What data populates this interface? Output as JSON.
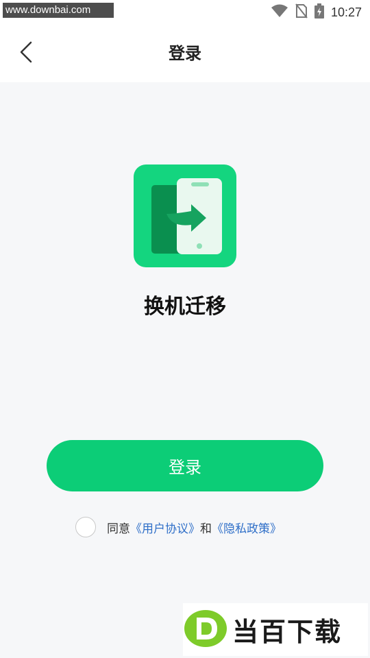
{
  "status_bar": {
    "watermark_url": "www.downbai.com",
    "time": "10:27"
  },
  "nav": {
    "title": "登录"
  },
  "app": {
    "name": "换机迁移"
  },
  "login": {
    "button_label": "登录"
  },
  "agreement": {
    "prefix": "同意",
    "user_agreement": "《用户协议》",
    "and": "和",
    "privacy_policy": "《隐私政策》"
  },
  "brand_watermark": {
    "text": "当百下载"
  },
  "colors": {
    "accent": "#0ccd77",
    "link": "#2f6fc8"
  }
}
